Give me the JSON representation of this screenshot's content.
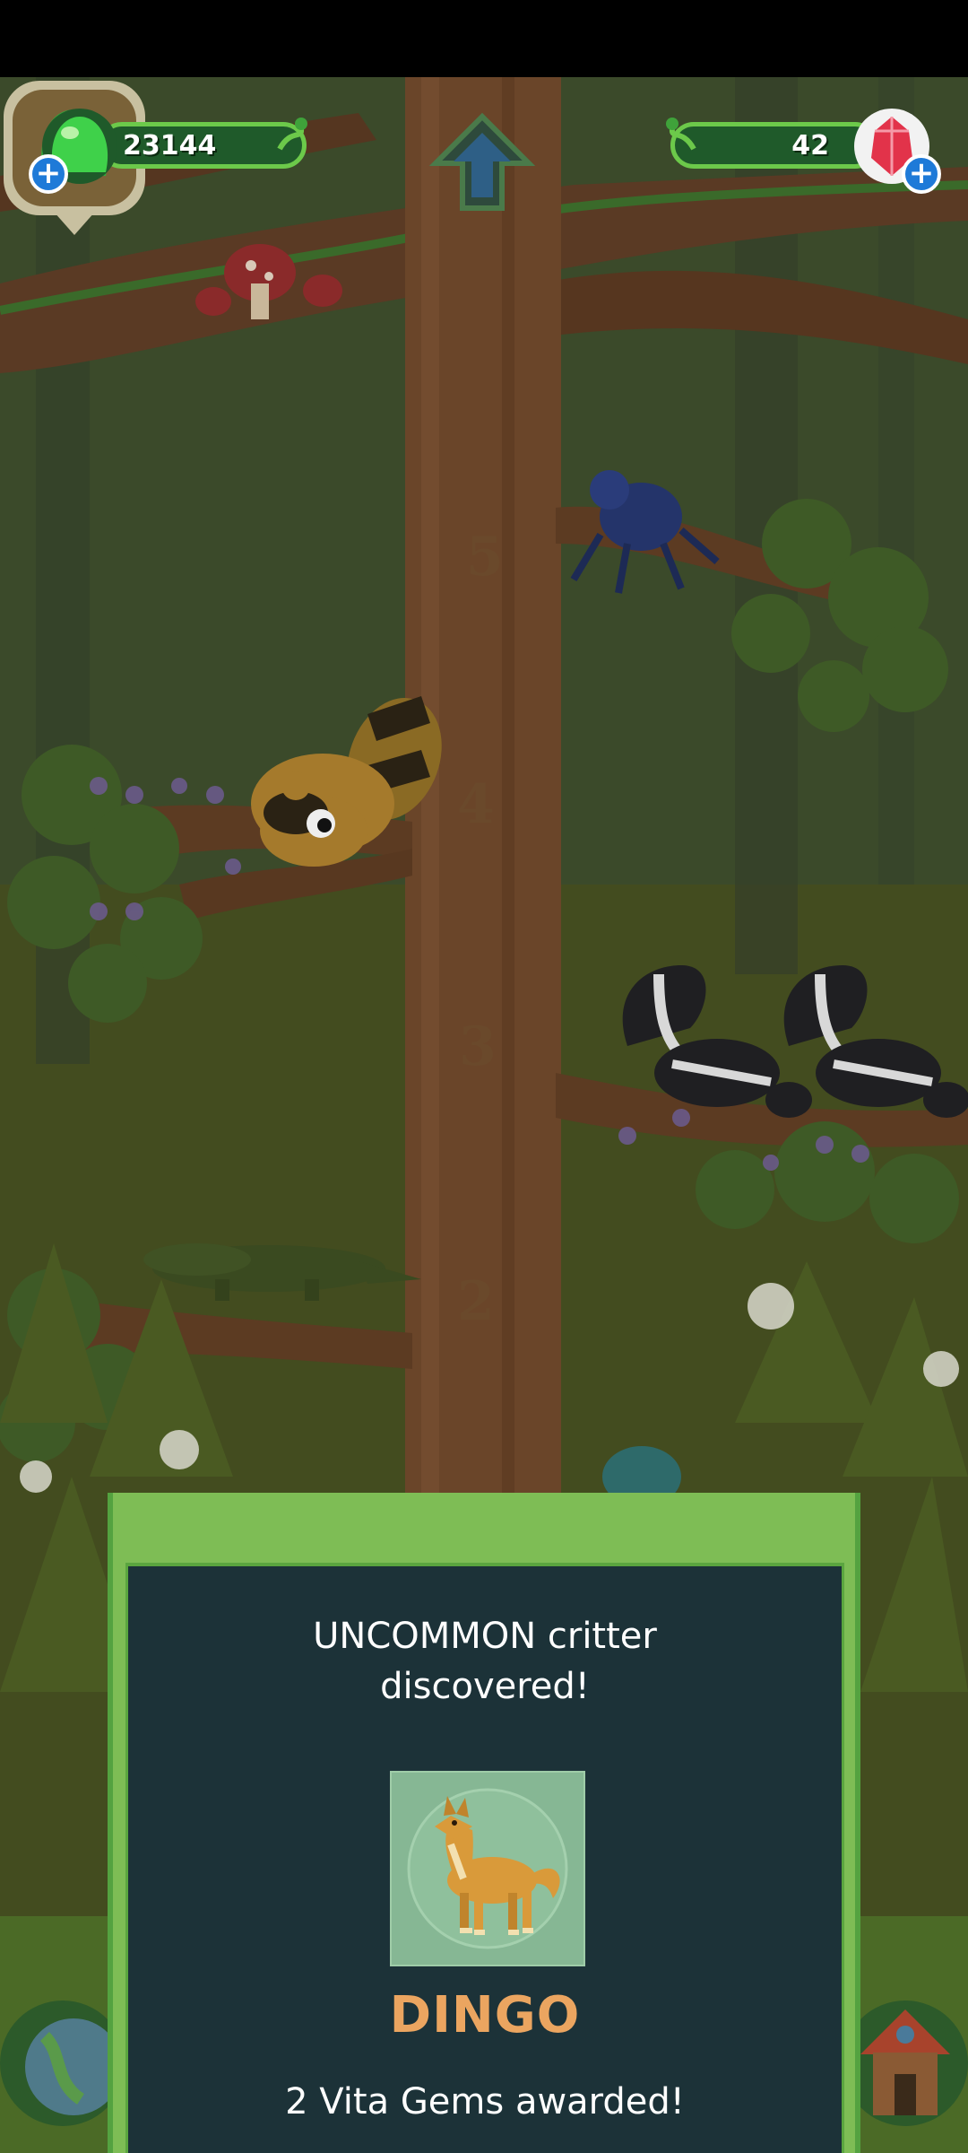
{
  "hud": {
    "jelly_count": "23144",
    "gem_count": "42",
    "plus_label": "+"
  },
  "tree": {
    "level_labels": [
      "5",
      "4",
      "3",
      "2"
    ]
  },
  "popup": {
    "heading_line1": "UNCOMMON critter",
    "heading_line2": "discovered!",
    "critter_name": "DINGO",
    "reward": "2 Vita Gems awarded!"
  },
  "colors": {
    "jelly_green": "#3fd14a",
    "gem_red": "#e2334a",
    "popup_green": "#7ebd55",
    "popup_dark": "#1c3238",
    "name_orange": "#eba560"
  },
  "icons": [
    "jelly-icon",
    "gem-icon",
    "plus-icon",
    "up-arrow-icon",
    "globe-icon",
    "house-icon"
  ]
}
